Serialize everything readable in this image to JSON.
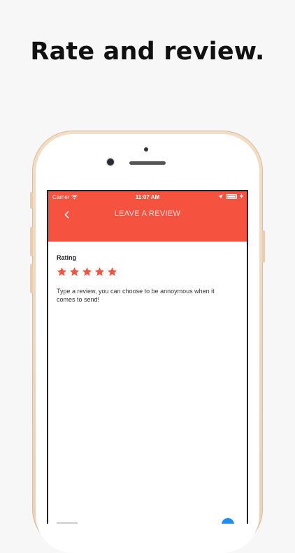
{
  "headline": "Rate and review.",
  "status_bar": {
    "carrier": "Carrier",
    "time": "11:07 AM"
  },
  "nav": {
    "title": "LEAVE A REVIEW",
    "back_icon": "chevron-left-icon"
  },
  "review": {
    "rating_label": "Rating",
    "rating_value": 5,
    "rating_max": 5,
    "placeholder": "Type a review, you can choose to be annoymous when it comes to send!"
  },
  "colors": {
    "accent": "#f55240",
    "star": "#f55240",
    "send": "#1e8ef0"
  }
}
